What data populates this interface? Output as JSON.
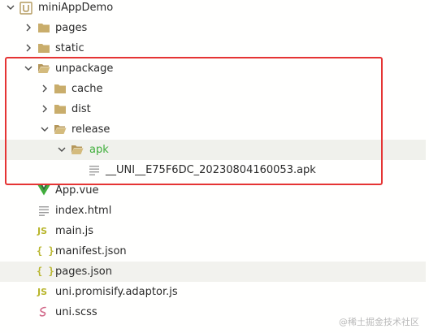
{
  "project": {
    "name": "miniAppDemo"
  },
  "tree": {
    "pages": "pages",
    "static": "static",
    "unpackage": "unpackage",
    "cache": "cache",
    "dist": "dist",
    "release": "release",
    "apk": "apk",
    "apk_file": "__UNI__E75F6DC_20230804160053.apk",
    "app_vue": "App.vue",
    "index_html": "index.html",
    "main_js": "main.js",
    "manifest_json": "manifest.json",
    "pages_json": "pages.json",
    "uni_promisify": "uni.promisify.adaptor.js",
    "uni_scss": "uni.scss"
  },
  "icons": {
    "js": "JS",
    "json": "{ }"
  },
  "watermark": "@稀土掘金技术社区",
  "colors": {
    "highlight_box": "#e53434",
    "folder": "#c9ad6b",
    "green_text": "#3fae3a",
    "js_badge": "#b8b52b"
  }
}
